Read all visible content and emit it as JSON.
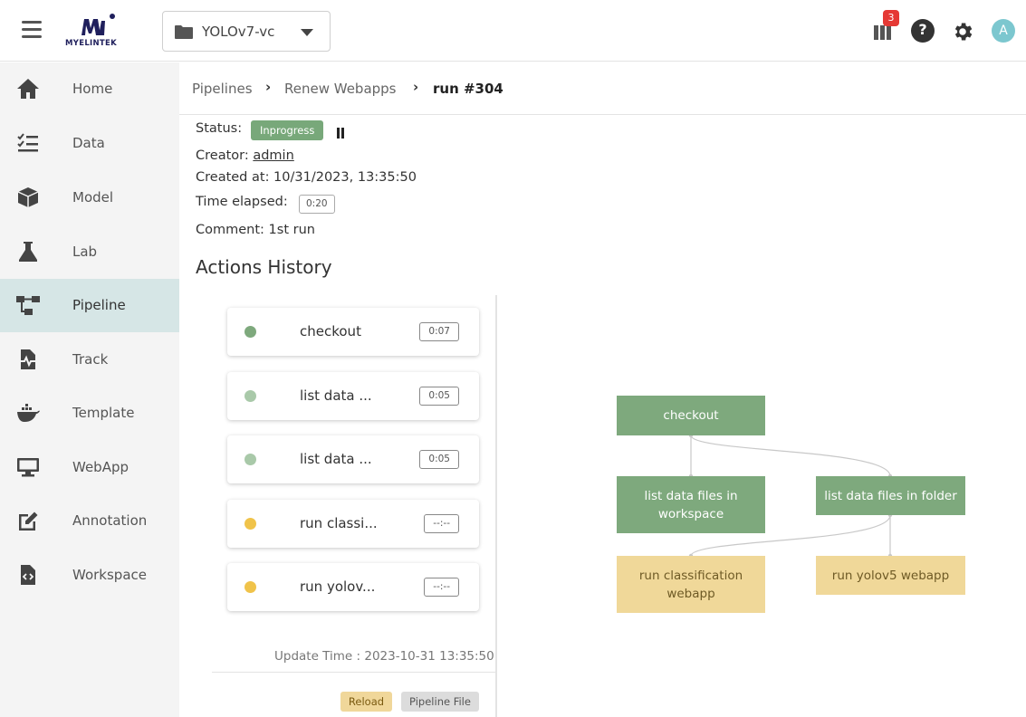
{
  "header": {
    "logo_text": "MYELINTEK",
    "project": "YOLOv7-vc",
    "notification_count": "3",
    "help_glyph": "?",
    "avatar_initial": "A"
  },
  "sidebar": {
    "items": [
      {
        "label": "Home",
        "icon": "home-icon"
      },
      {
        "label": "Data",
        "icon": "checklist-icon"
      },
      {
        "label": "Model",
        "icon": "cube-icon"
      },
      {
        "label": "Lab",
        "icon": "flask-icon"
      },
      {
        "label": "Pipeline",
        "icon": "pipeline-icon",
        "active": true
      },
      {
        "label": "Track",
        "icon": "track-icon"
      },
      {
        "label": "Template",
        "icon": "docker-icon"
      },
      {
        "label": "WebApp",
        "icon": "monitor-icon"
      },
      {
        "label": "Annotation",
        "icon": "edit-icon"
      },
      {
        "label": "Workspace",
        "icon": "code-file-icon"
      }
    ]
  },
  "breadcrumb": {
    "pipelines": "Pipelines",
    "pipeline": "Renew Webapps",
    "run": "run #304"
  },
  "run": {
    "status_label": "Status:",
    "status": "Inprogress",
    "creator_label": "Creator:",
    "creator": "admin",
    "created_at": "Created at: 10/31/2023, 13:35:50",
    "elapsed_label": "Time elapsed:",
    "elapsed": "0:20",
    "comment": "Comment: 1st run"
  },
  "actions_history": {
    "title": "Actions History",
    "items": [
      {
        "name": "checkout",
        "duration": "0:07",
        "state": "done"
      },
      {
        "name": "list data ...",
        "duration": "0:05",
        "state": "done"
      },
      {
        "name": "list data ...",
        "duration": "0:05",
        "state": "done"
      },
      {
        "name": "run classi...",
        "duration": "--:--",
        "state": "pending"
      },
      {
        "name": "run yolov...",
        "duration": "--:--",
        "state": "pending"
      }
    ],
    "update_time": "Update Time : 2023-10-31 13:35:50",
    "reload_label": "Reload",
    "pipeline_file_label": "Pipeline File"
  },
  "graph": {
    "nodes": [
      {
        "label": "checkout",
        "state": "done"
      },
      {
        "label": "list data files in workspace",
        "state": "done"
      },
      {
        "label": "list data files in folder",
        "state": "done"
      },
      {
        "label": "run classification webapp",
        "state": "pending"
      },
      {
        "label": "run yolov5 webapp",
        "state": "pending"
      }
    ]
  },
  "colors": {
    "accent_done": "#7ea97d",
    "accent_pending": "#f0d899",
    "dot_first": "#7ea97d",
    "dot_done": "#a9c9a9",
    "dot_pending": "#f0c34a",
    "sidebar_active": "#d6e6e6"
  }
}
